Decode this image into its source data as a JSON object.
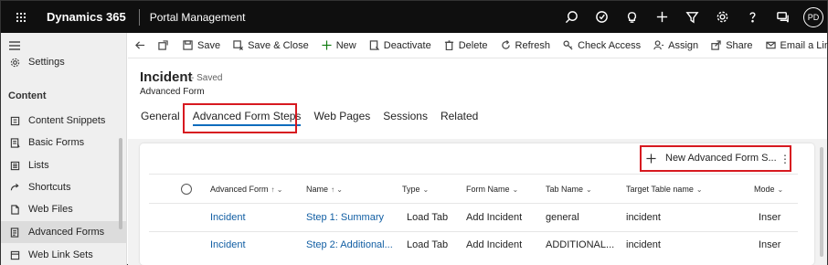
{
  "topbar": {
    "app_name": "Dynamics 365",
    "area_name": "Portal Management",
    "icons": [
      "search-icon",
      "task-icon",
      "lightbulb-icon",
      "plus-icon",
      "filter-icon",
      "gear-icon",
      "help-icon",
      "chat-icon"
    ],
    "avatar_initials": "PD"
  },
  "sidebar": {
    "items_top": [
      {
        "label": "Settings",
        "icon": "gear-icon"
      }
    ],
    "section_title": "Content",
    "items": [
      {
        "label": "Content Snippets",
        "icon": "snippet-icon"
      },
      {
        "label": "Basic Forms",
        "icon": "form-icon"
      },
      {
        "label": "Lists",
        "icon": "list-icon"
      },
      {
        "label": "Shortcuts",
        "icon": "shortcut-icon"
      },
      {
        "label": "Web Files",
        "icon": "file-icon"
      },
      {
        "label": "Advanced Forms",
        "icon": "advanced-form-icon"
      },
      {
        "label": "Web Link Sets",
        "icon": "link-icon"
      }
    ]
  },
  "commands": {
    "save": "Save",
    "save_close": "Save & Close",
    "new": "New",
    "deactivate": "Deactivate",
    "delete": "Delete",
    "refresh": "Refresh",
    "check_access": "Check Access",
    "assign": "Assign",
    "share": "Share",
    "email_link": "Email a Link"
  },
  "record": {
    "title": "Incident",
    "status": "- Saved",
    "entity": "Advanced Form"
  },
  "tabs": [
    "General",
    "Advanced Form Steps",
    "Web Pages",
    "Sessions",
    "Related"
  ],
  "subgrid": {
    "new_button": "New Advanced Form S...",
    "columns": [
      "Advanced Form",
      "Name",
      "Type",
      "Form Name",
      "Tab Name",
      "Target Table name",
      "Mode"
    ],
    "rows": [
      [
        "Incident",
        "Step 1: Summary",
        "Load Tab",
        "Add Incident",
        "general",
        "incident",
        "Inser"
      ],
      [
        "Incident",
        "Step 2: Additional...",
        "Load Tab",
        "Add Incident",
        "ADDITIONAL...",
        "incident",
        "Inser"
      ]
    ]
  },
  "colors": {
    "topbar": "#0f0f0f",
    "link": "#115ea3",
    "highlight": "#d71920",
    "tab_underline": "#0f6cbd"
  }
}
